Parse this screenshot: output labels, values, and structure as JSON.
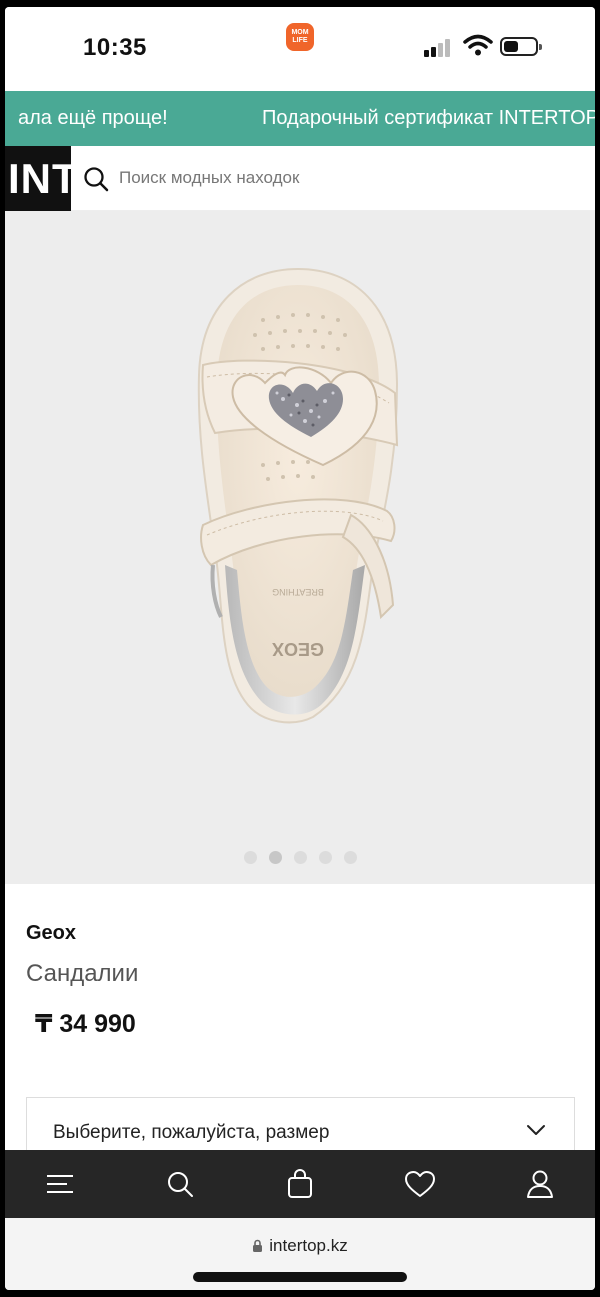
{
  "status_bar": {
    "time": "10:35",
    "app_badge_line1": "MOM",
    "app_badge_line2": "LIFE"
  },
  "promo": {
    "text_left": "ала ещё проще!",
    "text_right": "Подарочный сертификат INTERTOP"
  },
  "header": {
    "logo": "INTERTOP",
    "search_placeholder": "Поиск модных находок"
  },
  "gallery": {
    "image_count": 5,
    "active_index": 1
  },
  "product": {
    "brand": "Geox",
    "type": "Сандалии",
    "price": "₸ 34 990",
    "size_select_label": "Выберите, пожалуйста, размер"
  },
  "bottom_nav": {
    "items": [
      "menu-icon",
      "search-icon",
      "bag-icon",
      "heart-icon",
      "user-icon"
    ]
  },
  "browser": {
    "url": "intertop.kz"
  },
  "colors": {
    "promo_bg": "#4aa995",
    "nav_bg": "#262626",
    "gallery_bg": "#ededed"
  }
}
